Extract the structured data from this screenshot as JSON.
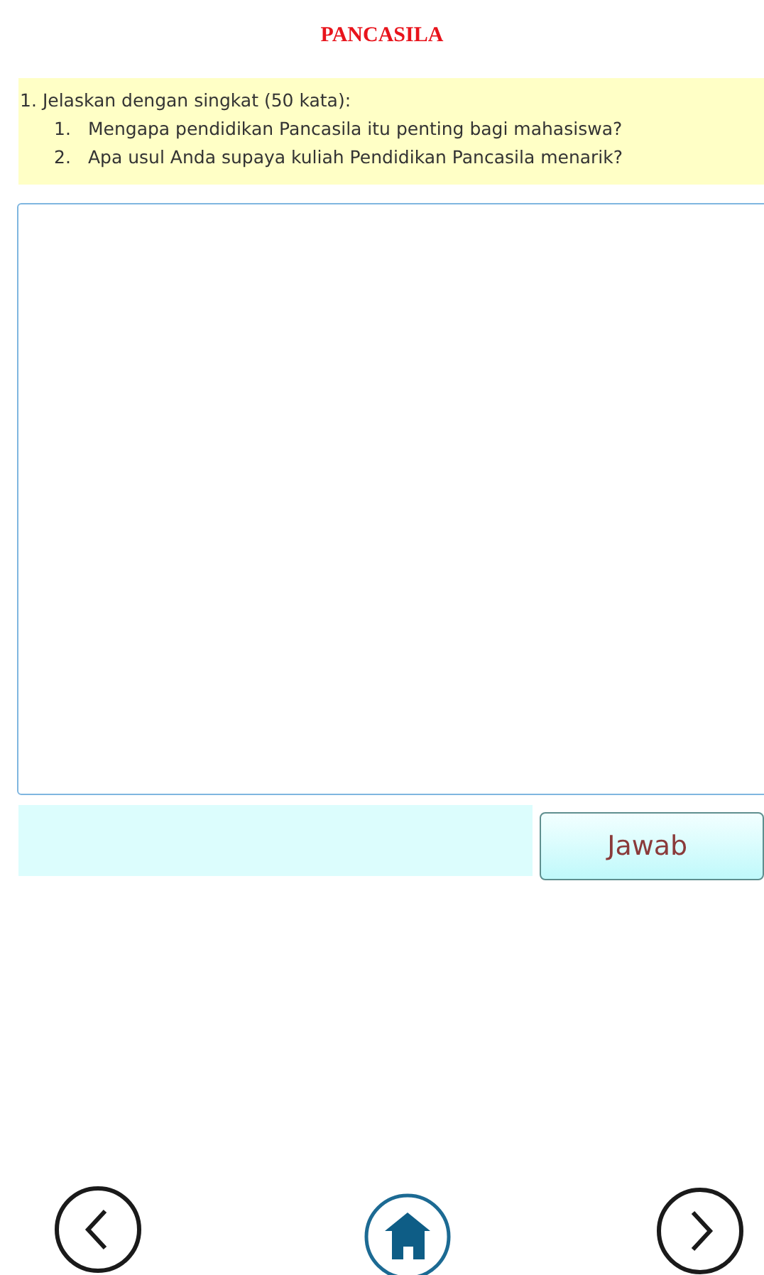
{
  "title": "PANCASILA",
  "question": {
    "number": "1.",
    "text": "Jelaskan dengan singkat (50 kata):",
    "items": [
      {
        "number": "1.",
        "text": "Mengapa pendidikan Pancasila itu penting bagi mahasiswa?"
      },
      {
        "number": "2.",
        "text": "Apa usul Anda supaya kuliah Pendidikan Pancasila menarik?"
      }
    ]
  },
  "submit_button": "Jawab"
}
